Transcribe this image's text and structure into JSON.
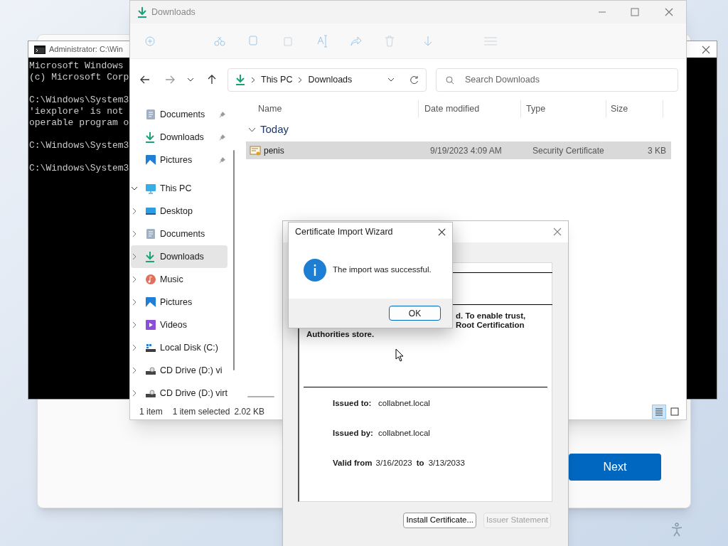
{
  "cmd_window": {
    "title": "Administrator: C:\\Win",
    "blocks": [
      [
        "Microsoft Windows",
        "(c) Microsoft Corp"
      ],
      [
        "C:\\Windows\\System3",
        "'iexplore' is not",
        "operable program o"
      ],
      [
        "C:\\Windows\\System3"
      ],
      [
        "C:\\Windows\\System3"
      ]
    ]
  },
  "setup_window": {
    "next_button": "Next"
  },
  "explorer": {
    "title": "Downloads",
    "address": [
      "This PC",
      "Downloads"
    ],
    "search_placeholder": "Search Downloads",
    "quick_access": [
      {
        "label": "Documents",
        "kind": "documents",
        "pinned": true,
        "selected": false
      },
      {
        "label": "Downloads",
        "kind": "downloads",
        "pinned": true,
        "selected": false
      },
      {
        "label": "Pictures",
        "kind": "pictures",
        "pinned": true,
        "selected": false
      }
    ],
    "tree": [
      {
        "label": "This PC",
        "kind": "pc",
        "expanded": true,
        "selected": false,
        "children": [
          {
            "label": "Desktop",
            "kind": "desktop",
            "expanded": false,
            "selected": false
          },
          {
            "label": "Documents",
            "kind": "documents",
            "expanded": false,
            "selected": false
          },
          {
            "label": "Downloads",
            "kind": "downloads",
            "expanded": false,
            "selected": true
          },
          {
            "label": "Music",
            "kind": "music",
            "expanded": false,
            "selected": false
          },
          {
            "label": "Pictures",
            "kind": "pictures",
            "expanded": false,
            "selected": false
          },
          {
            "label": "Videos",
            "kind": "videos",
            "expanded": false,
            "selected": false
          },
          {
            "label": "Local Disk (C:)",
            "kind": "disk",
            "expanded": false,
            "selected": false
          },
          {
            "label": "CD Drive (D:) vi",
            "kind": "cd",
            "expanded": false,
            "selected": false
          }
        ]
      },
      {
        "label": "CD Drive (D:) virt",
        "kind": "cd",
        "expanded": false,
        "selected": false
      }
    ],
    "columns": [
      "Name",
      "Date modified",
      "Type",
      "Size"
    ],
    "groups": [
      {
        "label": "Today",
        "expanded": true,
        "rows": [
          {
            "name": "penis",
            "date_modified": "9/19/2023 4:09 AM",
            "type": "Security Certificate",
            "size": "3 KB",
            "selected": true
          }
        ]
      }
    ],
    "status": {
      "count": "1 item",
      "selection": "1 item selected",
      "size": "2.02 KB"
    },
    "view_modes": [
      {
        "kind": "details",
        "selected": true
      },
      {
        "kind": "tiles",
        "selected": false
      }
    ]
  },
  "certificate_window": {
    "message_lines": [
      "d. To enable trust,",
      "Root Certification",
      "Authorities store."
    ],
    "fields": [
      {
        "label": "Issued to:",
        "value": "collabnet.local"
      },
      {
        "label": "Issued by:",
        "value": "collabnet.local"
      }
    ],
    "valid_from_label": "Valid from",
    "valid_from": "3/16/2023",
    "valid_to_label": "to",
    "valid_to": "3/13/2033",
    "buttons": [
      {
        "label": "Install Certificate...",
        "disabled": false
      },
      {
        "label": "Issuer Statement",
        "disabled": true
      }
    ]
  },
  "import_dialog": {
    "title": "Certificate Import Wizard",
    "message": "The import was successful.",
    "ok_button": "OK"
  }
}
